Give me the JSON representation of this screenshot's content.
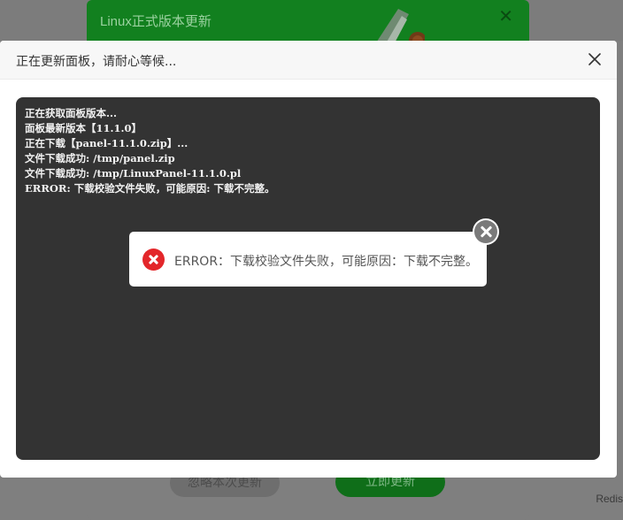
{
  "background": {
    "right_label": "Redis"
  },
  "update_dialog": {
    "title": "Linux正式版本更新",
    "skip_label": "忽略本次更新",
    "update_now_label": "立即更新"
  },
  "progress_dialog": {
    "title": "正在更新面板，请耐心等候...",
    "log_lines": [
      "正在获取面板版本...",
      "面板最新版本【11.1.0】",
      "正在下载【panel-11.1.0.zip】...",
      "文件下载成功: /tmp/panel.zip",
      "文件下载成功: /tmp/LinuxPanel-11.1.0.pl",
      "ERROR: 下载校验文件失败，可能原因: 下载不完整。"
    ]
  },
  "error_toast": {
    "message": "ERROR：下载校验文件失败，可能原因：下载不完整。",
    "icon": "error-icon",
    "color": "#e3262a"
  },
  "colors": {
    "console_bg": "#333333",
    "brand_green": "#20a53a"
  }
}
